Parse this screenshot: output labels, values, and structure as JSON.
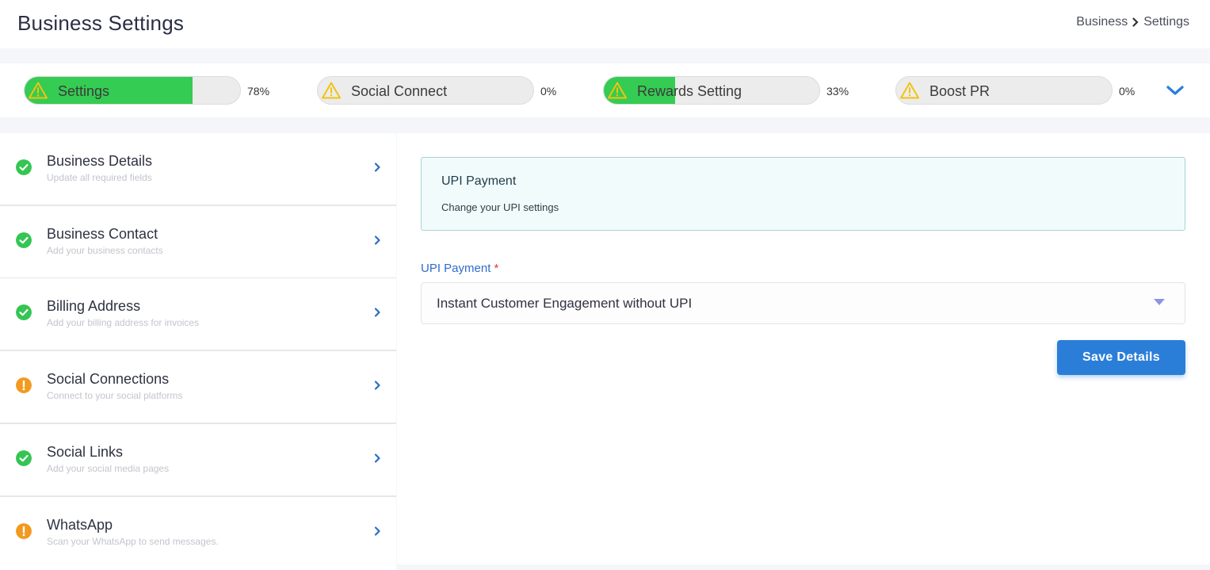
{
  "header": {
    "title": "Business Settings",
    "breadcrumb": [
      "Business",
      "Settings"
    ]
  },
  "progress": [
    {
      "label": "Settings",
      "percent_text": "78%",
      "percent": 78
    },
    {
      "label": "Social Connect",
      "percent_text": "0%",
      "percent": 0
    },
    {
      "label": "Rewards Setting",
      "percent_text": "33%",
      "percent": 33
    },
    {
      "label": "Boost PR",
      "percent_text": "0%",
      "percent": 0
    }
  ],
  "sidebar": {
    "items": [
      {
        "title": "Business Details",
        "subtitle": "Update all required fields",
        "status": "complete"
      },
      {
        "title": "Business Contact",
        "subtitle": "Add your business contacts",
        "status": "complete"
      },
      {
        "title": "Billing Address",
        "subtitle": "Add your billing address for invoices",
        "status": "complete"
      },
      {
        "title": "Social Connections",
        "subtitle": "Connect to your social platforms",
        "status": "warning"
      },
      {
        "title": "Social Links",
        "subtitle": "Add your social media pages",
        "status": "complete"
      },
      {
        "title": "WhatsApp",
        "subtitle": "Scan your WhatsApp to send messages.",
        "status": "warning"
      }
    ]
  },
  "main": {
    "card": {
      "title": "UPI Payment",
      "subtitle": "Change your UPI settings"
    },
    "field": {
      "label": "UPI Payment",
      "required_mark": "*",
      "value": "Instant Customer Engagement without UPI"
    },
    "save_label": "Save Details"
  },
  "colors": {
    "progress_fill": "#34cc52",
    "accent_blue": "#2b7ed8",
    "complete_green": "#34c552",
    "warning_orange": "#f29a1f",
    "warning_yellow": "#f4c20d"
  },
  "icons": {
    "progress_status": "warning-triangle-icon",
    "expand": "chevron-down-icon",
    "complete": "check-circle-icon",
    "warning": "exclamation-circle-icon",
    "row_nav": "chevron-right-icon",
    "select_caret": "caret-down-icon"
  }
}
